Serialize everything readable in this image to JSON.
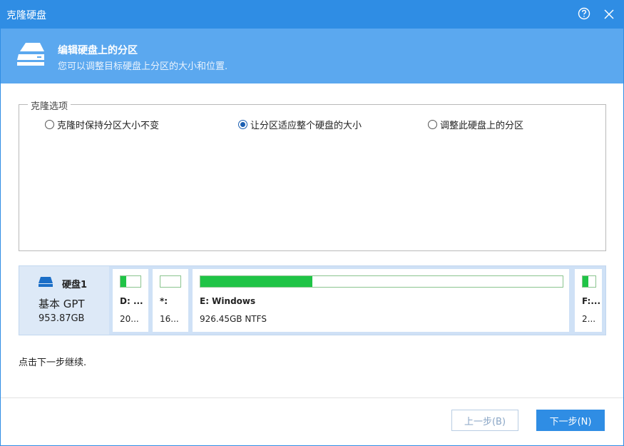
{
  "window": {
    "title": "克隆硬盘"
  },
  "header": {
    "title": "编辑硬盘上的分区",
    "subtitle": "您可以调整目标硬盘上分区的大小和位置."
  },
  "clone_options": {
    "legend": "克隆选项",
    "options": [
      {
        "label": "克隆时保持分区大小不变",
        "selected": false
      },
      {
        "label": "让分区适应整个硬盘的大小",
        "selected": true
      },
      {
        "label": "调整此硬盘上的分区",
        "selected": false
      }
    ]
  },
  "disk": {
    "name": "硬盘1",
    "type": "基本 GPT",
    "size": "953.87GB",
    "partitions": [
      {
        "name": "D: ...",
        "info": "20...",
        "used_fraction": 0.3
      },
      {
        "name": "*:",
        "info": "16...",
        "used_fraction": 0.0
      },
      {
        "name": "E: Windows",
        "info": "926.45GB NTFS",
        "used_fraction": 0.31
      },
      {
        "name": "F:...",
        "info": "2...",
        "used_fraction": 0.45
      }
    ]
  },
  "hint": "点击下一步继续.",
  "buttons": {
    "prev": "上一步(B)",
    "next": "下一步(N)"
  },
  "colors": {
    "titlebar": "#2f8de4",
    "header": "#5ba8ef",
    "used_bar": "#1fc446",
    "accent": "#1b5fb2"
  }
}
